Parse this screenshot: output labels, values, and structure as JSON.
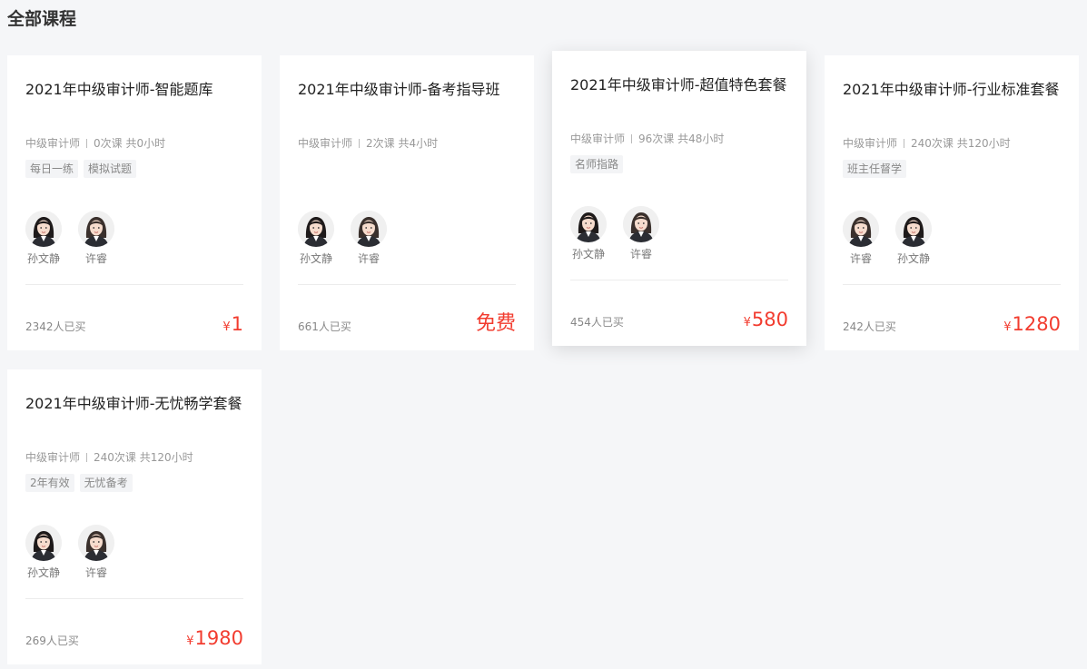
{
  "page": {
    "title": "全部课程"
  },
  "courses": [
    {
      "title": "2021年中级审计师-智能题库",
      "category": "中级审计师",
      "lessons": "0次课 共0小时",
      "tags": [
        "每日一练",
        "模拟试题"
      ],
      "teachers": [
        "孙文静",
        "许睿"
      ],
      "sold": "2342人已买",
      "currency": "¥",
      "price": "1",
      "hovered": false
    },
    {
      "title": "2021年中级审计师-备考指导班",
      "category": "中级审计师",
      "lessons": "2次课 共4小时",
      "tags": [],
      "teachers": [
        "孙文静",
        "许睿"
      ],
      "sold": "661人已买",
      "currency": "",
      "price": "免费",
      "hovered": false
    },
    {
      "title": "2021年中级审计师-超值特色套餐",
      "category": "中级审计师",
      "lessons": "96次课 共48小时",
      "tags": [
        "名师指路"
      ],
      "teachers": [
        "孙文静",
        "许睿"
      ],
      "sold": "454人已买",
      "currency": "¥",
      "price": "580",
      "hovered": true
    },
    {
      "title": "2021年中级审计师-行业标准套餐",
      "category": "中级审计师",
      "lessons": "240次课 共120小时",
      "tags": [
        "班主任督学"
      ],
      "teachers": [
        "许睿",
        "孙文静"
      ],
      "sold": "242人已买",
      "currency": "¥",
      "price": "1280",
      "hovered": false
    },
    {
      "title": "2021年中级审计师-无忧畅学套餐",
      "category": "中级审计师",
      "lessons": "240次课 共120小时",
      "tags": [
        "2年有效",
        "无忧备考"
      ],
      "teachers": [
        "孙文静",
        "许睿"
      ],
      "sold": "269人已买",
      "currency": "¥",
      "price": "1980",
      "hovered": false
    }
  ]
}
